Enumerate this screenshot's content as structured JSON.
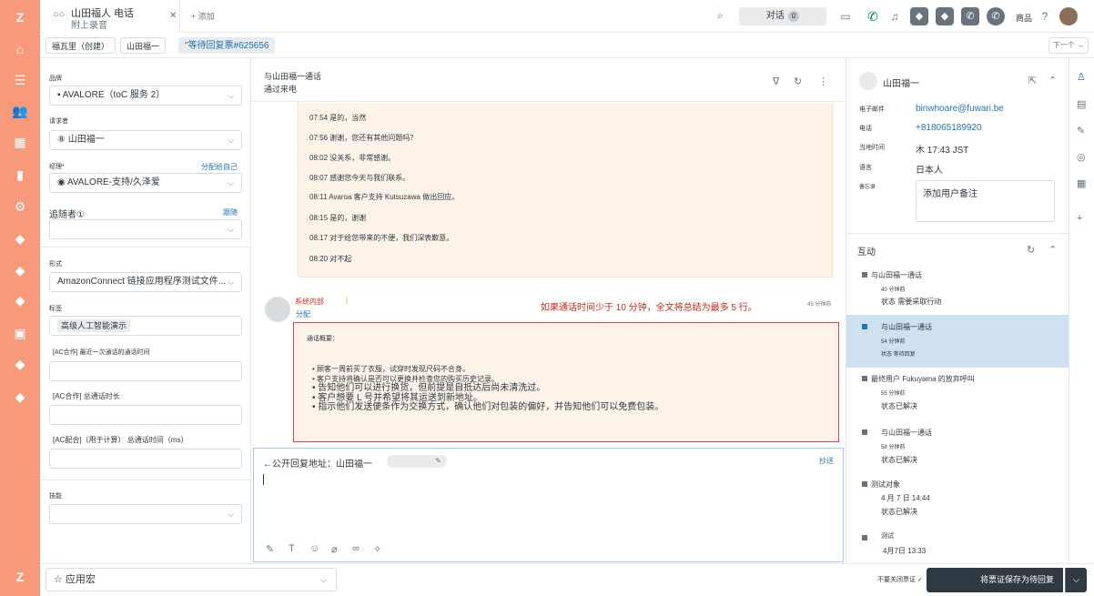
{
  "topbar": {
    "tab_title": "山田福人 电话",
    "tab_subtitle": "附上录音",
    "tab_add": "+ 添加",
    "conversations_label": "对话",
    "conversations_count": "0",
    "products_label": "商品"
  },
  "breadcrumbs": {
    "items": [
      "福瓦里（创建）",
      "山田福一"
    ],
    "selected": "\"等待回复票#625656",
    "next_label": "下一个 →"
  },
  "props": {
    "brand_label": "品牌",
    "brand_value": "AVALORE（toC 服务 2）",
    "requester_label": "请求者",
    "requester_value": "⑧ 山田福一",
    "assignee_label": "经理*",
    "assign_self": "分配给自己",
    "assignee_value": "AVALORE-支持/久泽爱",
    "followers_label": "追随者①",
    "followers_link": "跟随",
    "form_label": "形式",
    "form_value": "AmazonConnect 链接应用程序测试文件...",
    "tags_label": "标签",
    "tag_value": "高级人工智能演示",
    "last_call_label": "[AC合作] 最近一次通话的通话时间",
    "total_call_label": "[AC合作] 总通话时长",
    "total_call_ms_label": "[AC配合]（用于计算） 总通话时间（ms）",
    "skills_label": "技能"
  },
  "bottom": {
    "macro_label": "☆ 应用宏",
    "close_tab": "不要关闭票证 ✓",
    "submit_label": "将票证保存为待回复"
  },
  "conversation": {
    "title": "与山田福一通话",
    "subtitle": "通过来电",
    "transcript": [
      "07:54 是的，当然",
      "07:56 谢谢，您还有其他问题吗？",
      "08:02 没关系，非常感谢。",
      "08:07 感谢您今天与我们联系。",
      "08:11 Avaroa 客户支持 Kutsuzawa 做出回应。",
      "08:15 是的，谢谢",
      "08:17 对于给您带来的不便，我们深表歉意。",
      "08:20 对不起"
    ],
    "note_author": "系统内部",
    "note_assign": "分配",
    "note_hint": "如果通话时间少于 10 分钟，全文将总结为最多 5 行。",
    "note_time": "45 分钟前",
    "summary_label": "通话概要：",
    "summary": [
      "• 顾客一周前买了衣服，试穿时发现尺码不合身。",
      "• 客户支持将确认是否可以更换并检查您的购买历史记录。",
      "• 告知他们可以进行换货，但前提是自抵达后尚未清洗过。",
      "• 客户想要 L 号并希望将其运送到新地址。",
      "• 指示他们发送便条作为交换方式，确认他们对包装的偏好，并告知他们可以免费包装。"
    ],
    "reply_to": "←公开回复地址：山田福一",
    "cc_label": "抄送"
  },
  "user": {
    "name": "山田福一",
    "email_label": "电子邮件",
    "email": "binwhoare@fuwari.be",
    "phone_label": "电话",
    "phone": "+818065189920",
    "localtime_label": "当地时间",
    "localtime": "木 17:43 JST",
    "language_label": "语言",
    "language": "日本人",
    "notes_label": "备忘录",
    "notes_placeholder": "添加用户备注",
    "interactions_title": "互动",
    "interactions": [
      {
        "title": "与山田福一通话",
        "time": "40 分钟前",
        "status": "状态 需要采取行动"
      },
      {
        "title": "与山田福一通话",
        "time": "54 分钟前",
        "status": "状态 等待回复"
      },
      {
        "title": "最终用户 Fukuyama 的放弃呼叫",
        "time": "55 分钟前",
        "status": "状态已解决"
      },
      {
        "title": "与山田福一通话",
        "time": "58 分钟前",
        "status": "状态已解决"
      },
      {
        "title": "测试对象",
        "time": "4 月 7 日 14:44",
        "status": "状态已解决"
      },
      {
        "title": "测试",
        "time": "4月7日 13:33",
        "status": ""
      }
    ]
  },
  "colors": {
    "rail": "#f79a7c",
    "accent": "#1f73b7",
    "note_border": "#d93f4c",
    "note_bg": "#fdf3e8",
    "selected_row": "#cfe0f0",
    "call_green": "#038153"
  }
}
